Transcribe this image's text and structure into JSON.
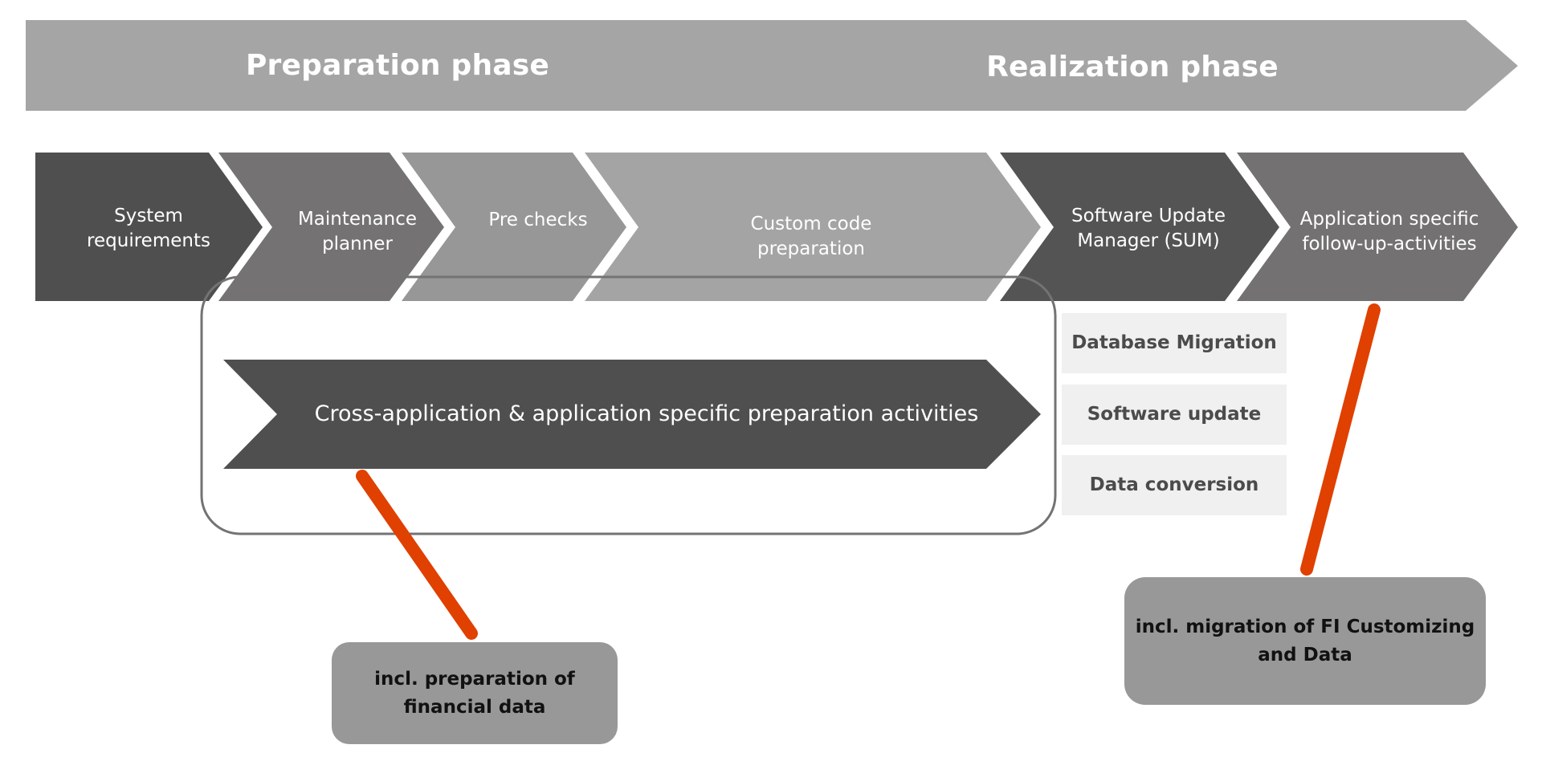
{
  "phases": [
    {
      "label": "Preparation phase"
    },
    {
      "label": "Realization phase"
    }
  ],
  "steps": [
    {
      "label_line1": "System",
      "label_line2": "requirements",
      "color": "#4f4f4f"
    },
    {
      "label_line1": "Maintenance",
      "label_line2": "planner",
      "color": "#747273"
    },
    {
      "label_line1": "Pre checks",
      "label_line2": "",
      "color": "#979797"
    },
    {
      "label_line1": "Custom code",
      "label_line2": "preparation",
      "color": "#a4a4a4"
    },
    {
      "label_line1": "Software Update",
      "label_line2": "Manager (SUM)",
      "color": "#545454"
    },
    {
      "label_line1": "Application specific",
      "label_line2": "follow-up-activities",
      "color": "#737172"
    }
  ],
  "preparation_activities": {
    "label": "Cross-application & application specific preparation activities",
    "color": "#4f4f4f"
  },
  "sum_substeps": [
    {
      "label": "Database Migration"
    },
    {
      "label": "Software update"
    },
    {
      "label": "Data conversion"
    }
  ],
  "callouts": [
    {
      "label_line1": "incl. preparation of",
      "label_line2": "financial data"
    },
    {
      "label_line1": "incl. migration of FI Customizing",
      "label_line2": "and Data"
    }
  ],
  "colors": {
    "phase_banner": "#a5a5a5",
    "substep_bg": "#f0f0f0",
    "callout_bg": "#989898",
    "connector": "#e04000",
    "group_border": "#737373"
  }
}
